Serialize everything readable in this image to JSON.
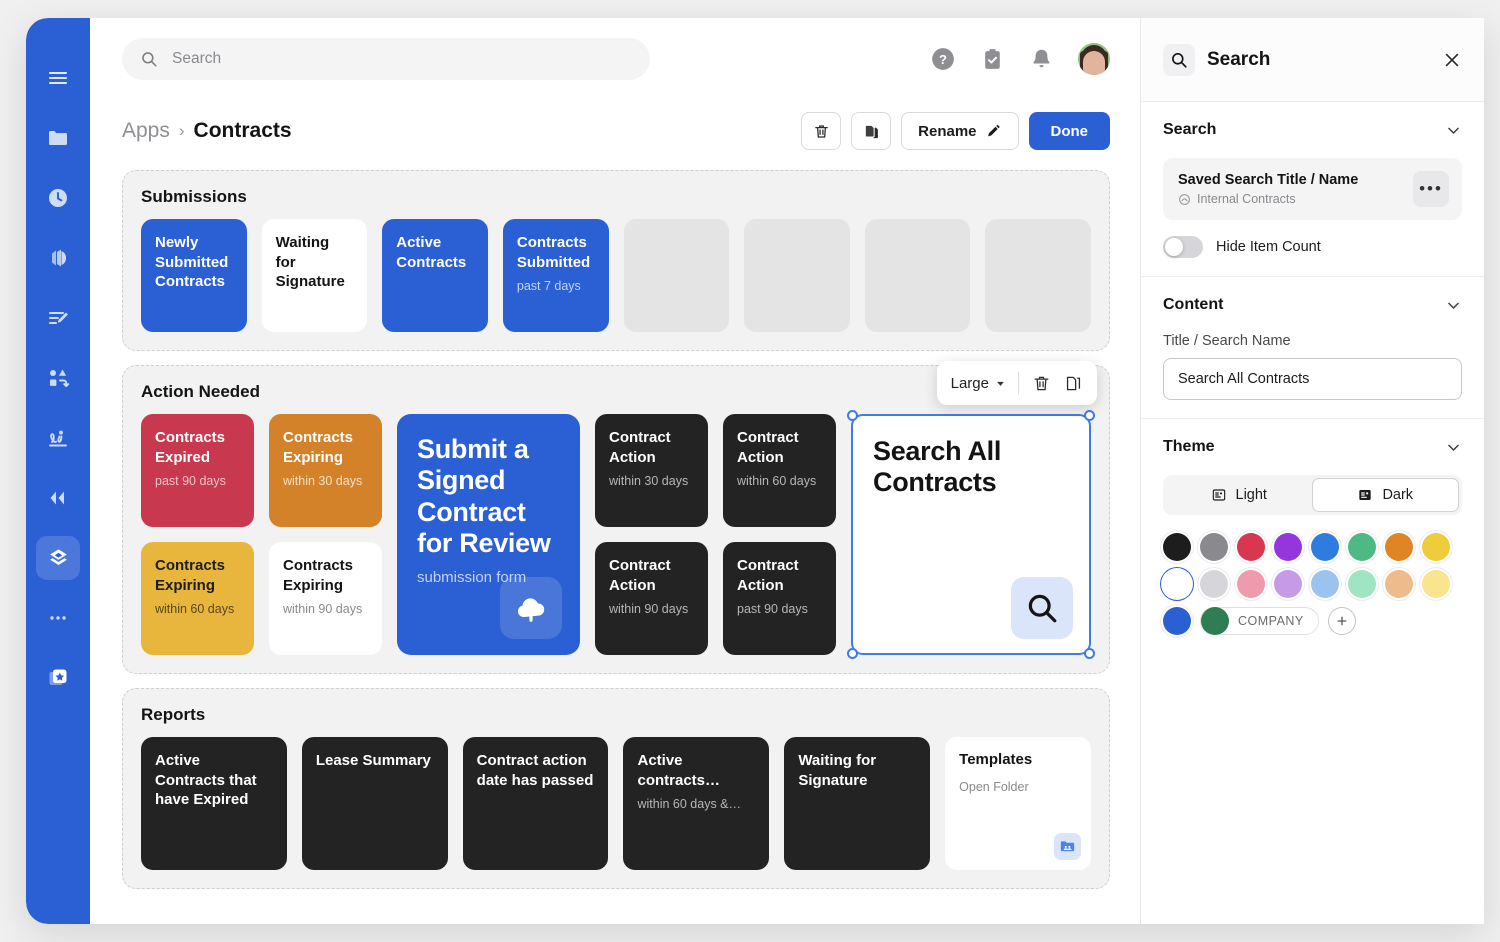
{
  "rail": {
    "items": [
      {
        "name": "menu-icon",
        "label": "Menu"
      },
      {
        "name": "folder-icon",
        "label": "Files"
      },
      {
        "name": "clock-icon",
        "label": "Recent"
      },
      {
        "name": "layers-stack-icon",
        "label": "Collections"
      },
      {
        "name": "edit-list-icon",
        "label": "Forms"
      },
      {
        "name": "shapes-icon",
        "label": "Shapes"
      },
      {
        "name": "signature-icon",
        "label": "Signature"
      },
      {
        "name": "collapse-left-icon",
        "label": "Collapse"
      },
      {
        "name": "layers-diamond-icon",
        "label": "Apps"
      },
      {
        "name": "more-dots-icon",
        "label": "More"
      },
      {
        "name": "star-card-icon",
        "label": "Favorites"
      }
    ]
  },
  "topbar": {
    "search_placeholder": "Search",
    "help_label": "Help",
    "tasks_label": "Tasks",
    "notifications_label": "Notifications",
    "avatar_label": "Account"
  },
  "breadcrumb": {
    "parent": "Apps",
    "separator": "›",
    "current": "Contracts"
  },
  "actions": {
    "delete_label": "Delete",
    "duplicate_label": "Duplicate",
    "rename_label": "Rename",
    "done_label": "Done"
  },
  "sections": [
    {
      "title": "Submissions",
      "tiles": [
        {
          "title": "Newly Submitted Contracts",
          "sub": "",
          "style": "t-blue"
        },
        {
          "title": "Waiting for Signature",
          "sub": "",
          "style": "t-white"
        },
        {
          "title": "Active Contracts",
          "sub": "",
          "style": "t-blue"
        },
        {
          "title": "Contracts Submitted",
          "sub": "past 7 days",
          "style": "t-blue"
        },
        {
          "title": "",
          "sub": "",
          "style": "t-empty"
        },
        {
          "title": "",
          "sub": "",
          "style": "t-empty"
        },
        {
          "title": "",
          "sub": "",
          "style": "t-empty"
        },
        {
          "title": "",
          "sub": "",
          "style": "t-empty"
        }
      ]
    }
  ],
  "action_needed": {
    "title": "Action Needed",
    "left_tiles": [
      {
        "title": "Contracts Expired",
        "sub": "past 90 days",
        "style": "t-red"
      },
      {
        "title": "Contracts Expiring",
        "sub": "within 30 days",
        "style": "t-orange"
      },
      {
        "title": "Contracts Expiring",
        "sub": "within 60 days",
        "style": "t-yellow"
      },
      {
        "title": "Contracts Expiring",
        "sub": "within 90 days",
        "style": "t-white"
      }
    ],
    "feature_card": {
      "title": "Submit a Signed Contract for Review",
      "sub": "submission form",
      "icon": "cloud-upload-icon"
    },
    "dark_tiles": [
      {
        "title": "Contract Action",
        "sub": "within 30 days"
      },
      {
        "title": "Contract Action",
        "sub": "within 60 days"
      },
      {
        "title": "Contract Action",
        "sub": "within 90 days"
      },
      {
        "title": "Contract Action",
        "sub": "past 90 days"
      }
    ],
    "selected_tile": {
      "title": "Search All Contracts",
      "icon": "search-icon"
    },
    "float_toolbar": {
      "size_label": "Large",
      "delete_label": "Delete",
      "duplicate_label": "Duplicate"
    }
  },
  "reports": {
    "title": "Reports",
    "tiles": [
      {
        "title": "Active Contracts that have Expired",
        "sub": ""
      },
      {
        "title": "Lease Summary",
        "sub": ""
      },
      {
        "title": "Contract action date has passed",
        "sub": ""
      },
      {
        "title": "Active contracts…",
        "sub": "within 60 days &…"
      },
      {
        "title": "Waiting for Signature",
        "sub": ""
      }
    ],
    "templates_card": {
      "title": "Templates",
      "sub": "Open Folder",
      "icon": "folder-users-icon"
    }
  },
  "panel": {
    "header_title": "Search",
    "close_label": "Close",
    "search_section": {
      "title": "Search",
      "saved": {
        "title": "Saved Search Title / Name",
        "subtitle": "Internal Contracts",
        "more_label": "•••"
      },
      "hide_item_count_label": "Hide Item Count",
      "hide_item_count_on": false
    },
    "content_section": {
      "title": "Content",
      "field_label": "Title / Search Name",
      "field_value": "Search All Contracts",
      "field_placeholder": "Search All Contracts"
    },
    "theme_section": {
      "title": "Theme",
      "light_label": "Light",
      "dark_label": "Dark",
      "selected_mode": "Dark",
      "swatch_rows": [
        [
          "#1d1d1d",
          "#8a8a8e",
          "#d9374f",
          "#9435dd",
          "#2f7ce0",
          "#4dba83",
          "#e08526",
          "#f0cb3a"
        ],
        [
          "#ffffff",
          "#d6d6da",
          "#ef9aad",
          "#c79ae8",
          "#9cc3ef",
          "#9fe4c3",
          "#eebb8d",
          "#f8e58d"
        ]
      ],
      "selected_swatch": "#ffffff",
      "extra_swatch": "#2b5fd4",
      "company_swatch": "#2f7d52",
      "company_label": "COMPANY",
      "add_label": "+"
    }
  }
}
